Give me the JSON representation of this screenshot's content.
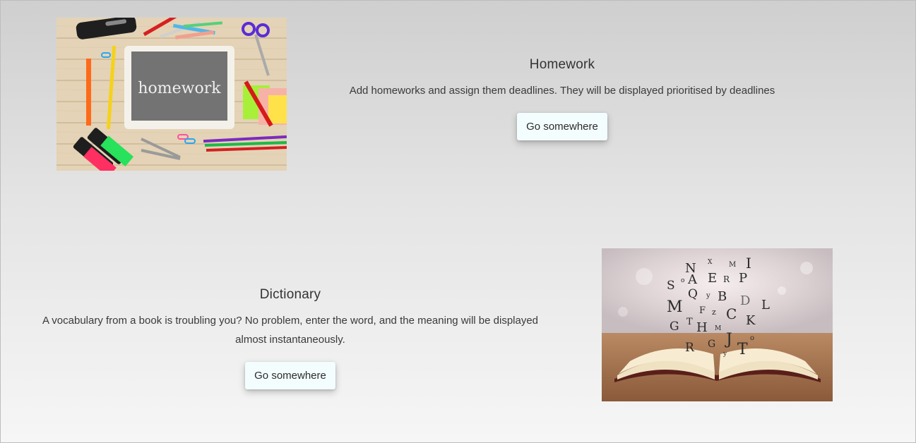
{
  "features": [
    {
      "title": "Homework",
      "description": "Add homeworks and assign them deadlines. They will be displayed prioritised by deadlines",
      "button_label": "Go somewhere",
      "image": {
        "alt": "homework",
        "tablet_text": "homework"
      }
    },
    {
      "title": "Dictionary",
      "description": "A vocabulary from a book is troubling you? No problem, enter the word, and the meaning will be displayed almost instantaneously.",
      "button_label": "Go somewhere",
      "image": {
        "alt": "open book with flying letters",
        "letters": [
          "N",
          "X",
          "M",
          "I",
          "S",
          "o",
          "A",
          "E",
          "R",
          "P",
          "Q",
          "y",
          "B",
          "D",
          "M",
          "F",
          "z",
          "C",
          "L",
          "G",
          "T",
          "H",
          "M",
          "K",
          "R",
          "G",
          "J",
          "T",
          "o",
          "y"
        ]
      }
    }
  ],
  "colors": {
    "button_bg": "#f3fdfd",
    "page_top": "#cfcfcf",
    "page_bottom": "#f6f6f6"
  }
}
